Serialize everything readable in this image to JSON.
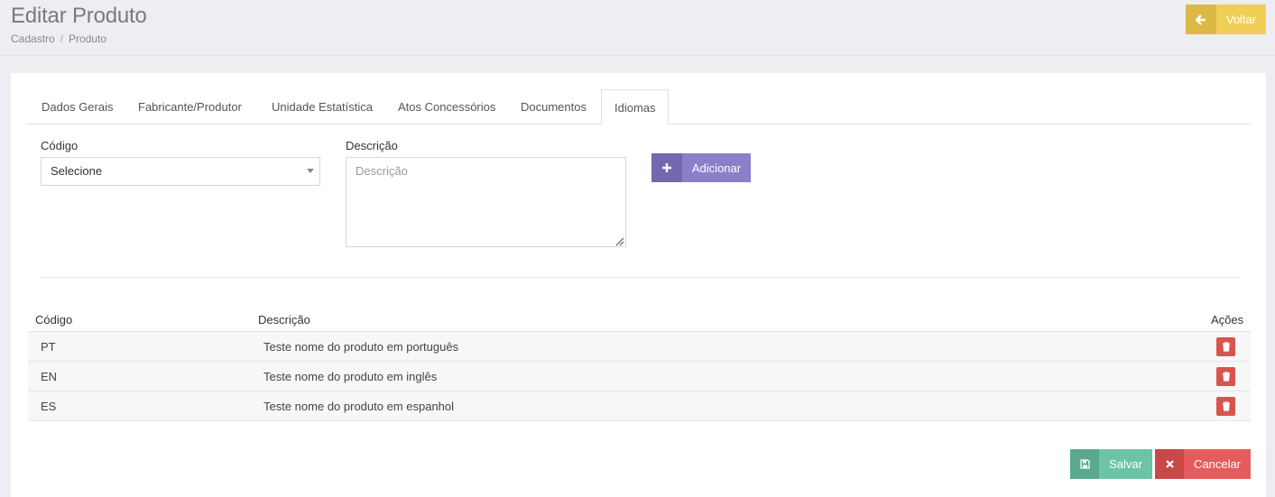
{
  "header": {
    "title": "Editar Produto",
    "breadcrumb": [
      "Cadastro",
      "Produto"
    ],
    "back_label": "Voltar"
  },
  "tabs": [
    {
      "label": "Dados Gerais",
      "active": false
    },
    {
      "label": "Fabricante/Produtor",
      "active": false
    },
    {
      "label": "Unidade Estatística",
      "active": false
    },
    {
      "label": "Atos Concessórios",
      "active": false
    },
    {
      "label": "Documentos",
      "active": false
    },
    {
      "label": "Idiomas",
      "active": true
    }
  ],
  "form": {
    "codigo_label": "Código",
    "codigo_value": "Selecione",
    "descricao_label": "Descrição",
    "descricao_placeholder": "Descrição",
    "add_label": "Adicionar"
  },
  "table": {
    "headers": {
      "codigo": "Código",
      "descricao": "Descrição",
      "acoes": "Ações"
    },
    "rows": [
      {
        "codigo": "PT",
        "descricao": "Teste nome do produto em português"
      },
      {
        "codigo": "EN",
        "descricao": "Teste nome do produto em inglês"
      },
      {
        "codigo": "ES",
        "descricao": "Teste nome do produto em espanhol"
      }
    ]
  },
  "actions": {
    "save_label": "Salvar",
    "cancel_label": "Cancelar"
  },
  "colors": {
    "back": "#f1cf56",
    "add": "#8c7fca",
    "save": "#6cc4a5",
    "cancel": "#e65c5c",
    "delete": "#d9534f"
  }
}
